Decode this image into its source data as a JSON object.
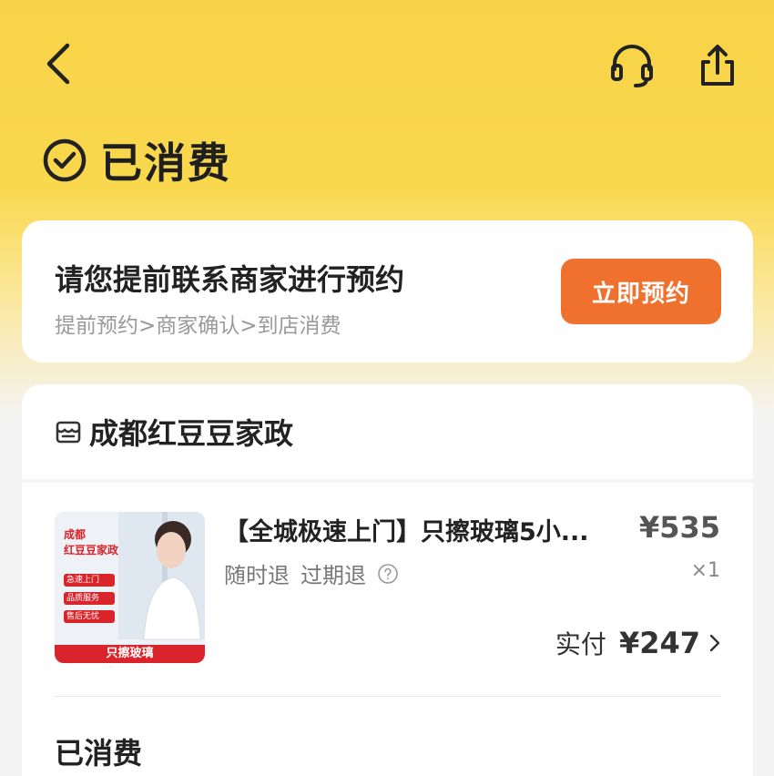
{
  "nav": {
    "back_icon": "chevron-left-icon",
    "service_icon": "headset-icon",
    "share_icon": "share-icon"
  },
  "status": {
    "icon": "check-circle-icon",
    "text": "已消费"
  },
  "booking": {
    "title": "请您提前联系商家进行预约",
    "steps": "提前预约>商家确认>到店消费",
    "button_label": "立即预约",
    "button_color": "#f0702d"
  },
  "order": {
    "shop_icon": "store-icon",
    "shop_name": "成都红豆豆家政",
    "product": {
      "title": "【全城极速上门】只擦玻璃5小...",
      "price": "¥535",
      "tags": [
        "随时退",
        "过期退"
      ],
      "help_icon": "question-circle-icon",
      "quantity": "×1",
      "paid_label": "实付",
      "paid_amount": "¥247",
      "image": {
        "city": "成都",
        "brand": "红豆豆家政",
        "features": [
          "急速上门",
          "品质服务",
          "售后无忧"
        ],
        "banner": "只擦玻璃"
      }
    },
    "bottom_status": "已消费"
  },
  "colors": {
    "header_yellow": "#f8d347",
    "accent_orange": "#f0702d",
    "image_red": "#d9242b"
  }
}
